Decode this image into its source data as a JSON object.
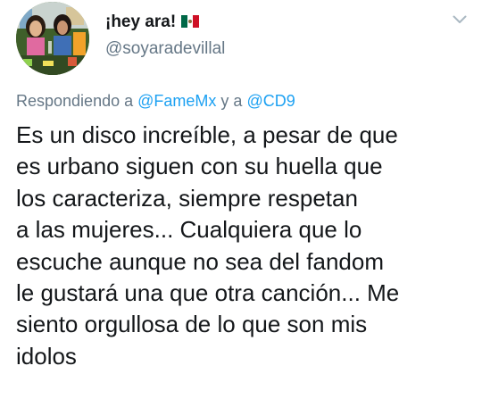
{
  "author": {
    "display_name": "¡hey ara!",
    "flag_icon": "mexico-flag-icon",
    "handle": "@soyaradevillal"
  },
  "menu": {
    "icon": "chevron-down-icon",
    "color": "#aab8c2"
  },
  "reply": {
    "prefix": "Respondiendo a",
    "mention_1": "@FameMx",
    "connector": "y a",
    "mention_2": "@CD9"
  },
  "tweet": {
    "lines": [
      "Es un disco increíble, a pesar de que",
      "es urbano siguen con su huella que",
      "los caracteriza, siempre respetan",
      "a las mujeres... Cualquiera que lo",
      "escuche aunque no sea del fandom",
      "le gustará una que otra canción... Me",
      "siento orgullosa de lo que son mis",
      "idolos"
    ]
  },
  "colors": {
    "text": "#14171a",
    "secondary": "#657786",
    "link": "#1da1f2"
  }
}
